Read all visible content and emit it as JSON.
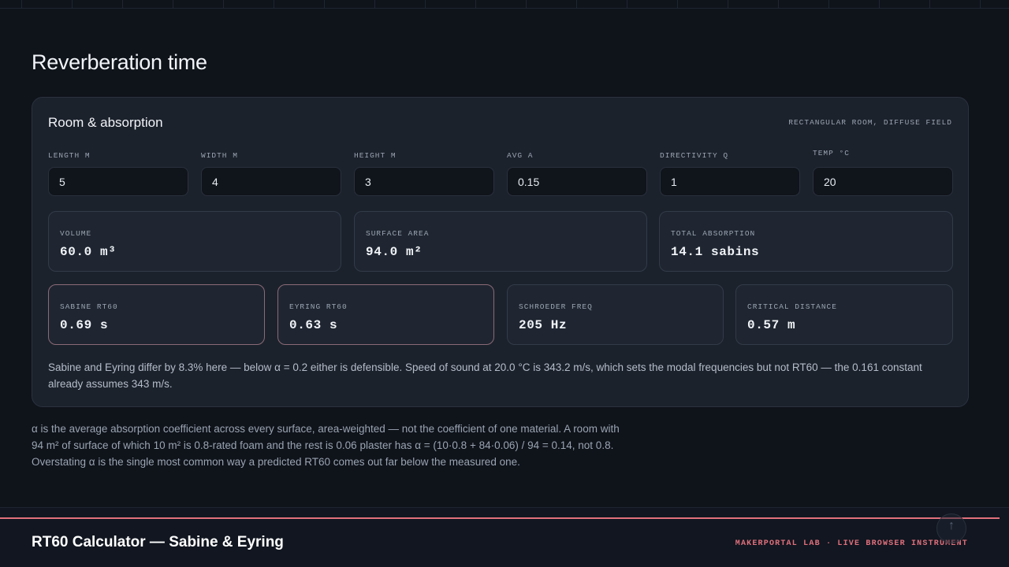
{
  "header": {
    "title": "Reverberation time"
  },
  "card": {
    "title": "Room & absorption",
    "tag": "RECTANGULAR ROOM, DIFFUSE FIELD",
    "inputs": [
      {
        "label": "LENGTH M",
        "value": "5"
      },
      {
        "label": "WIDTH M",
        "value": "4"
      },
      {
        "label": "HEIGHT M",
        "value": "3"
      },
      {
        "label": "AVG Α",
        "value": "0.15"
      },
      {
        "label": "DIRECTIVITY Q",
        "value": "1"
      },
      {
        "label": "TEMP °C",
        "value": "20"
      }
    ],
    "derived": [
      {
        "label": "VOLUME",
        "value": "60.0 m³"
      },
      {
        "label": "SURFACE AREA",
        "value": "94.0 m²"
      },
      {
        "label": "TOTAL ABSORPTION",
        "value": "14.1 sabins"
      }
    ],
    "results": [
      {
        "label": "SABINE RT60",
        "value": "0.69 s"
      },
      {
        "label": "EYRING RT60",
        "value": "0.63 s"
      },
      {
        "label": "SCHROEDER FREQ",
        "value": "205 Hz"
      },
      {
        "label": "CRITICAL DISTANCE",
        "value": "0.57 m"
      }
    ],
    "note": "Sabine and Eyring differ by 8.3% here — below α = 0.2 either is defensible. Speed of sound at 20.0 °C is 343.2 m/s, which sets the modal frequencies but not RT60 — the 0.161 constant already assumes 343 m/s."
  },
  "footnote": "α is the average absorption coefficient across every surface, area-weighted — not the coefficient of one material. A room with 94 m² of surface of which 10 m² is 0.8-rated foam and the rest is 0.06 plaster has α = (10·0.8 + 84·0.06) / 94 = 0.14, not 0.8. Overstating α is the single most common way a predicted RT60 comes out far below the measured one.",
  "footer": {
    "title": "RT60 Calculator — Sabine & Eyring",
    "tag": "MAKERPORTAL LAB · LIVE BROWSER INSTRUMENT",
    "scroll_top_icon": "↑"
  },
  "colors": {
    "background": "#0f131a",
    "card": "#1c222c",
    "accent": "#e0707c",
    "highlight_border": "#8a6a76"
  }
}
